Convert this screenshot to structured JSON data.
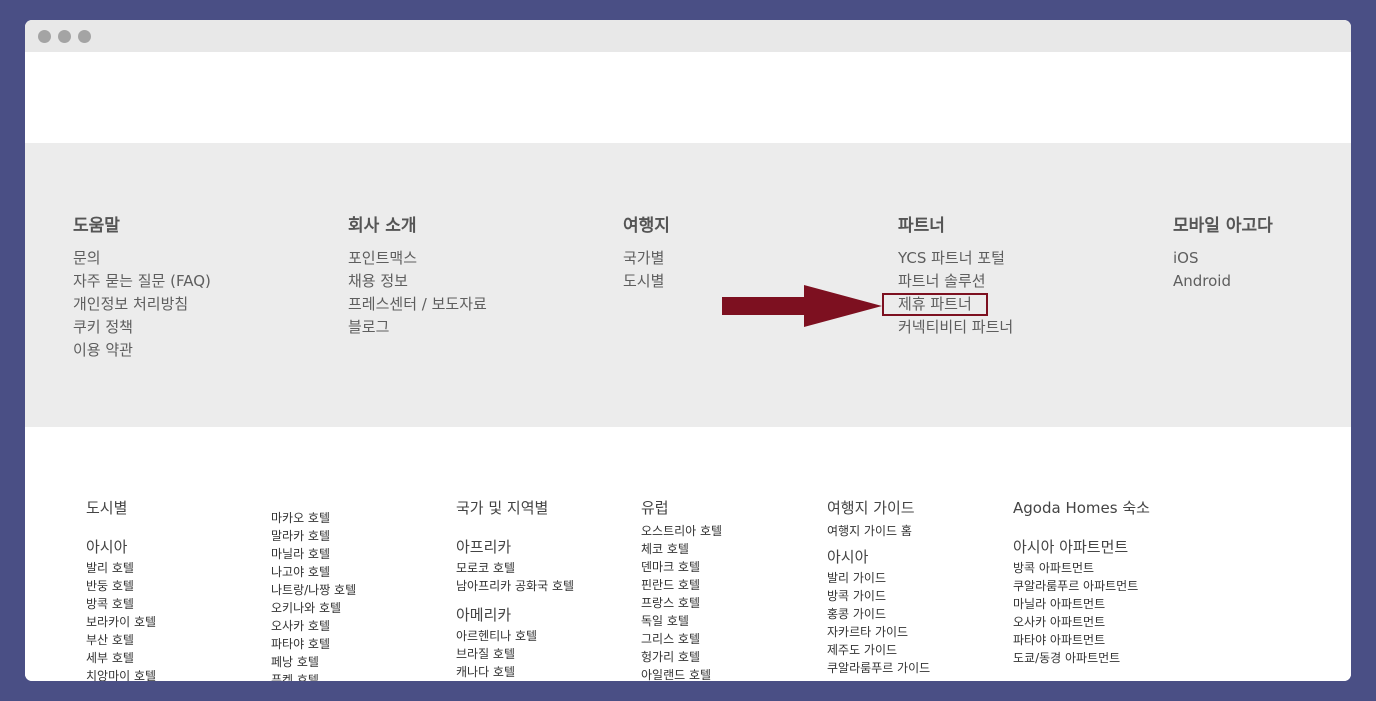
{
  "footer": {
    "columns": [
      {
        "title": "도움말",
        "links": [
          "문의",
          "자주 묻는 질문 (FAQ)",
          "개인정보 처리방침",
          "쿠키 정책",
          "이용 약관"
        ]
      },
      {
        "title": "회사 소개",
        "links": [
          "포인트맥스",
          "채용 정보",
          "프레스센터 / 보도자료",
          "블로그"
        ]
      },
      {
        "title": "여행지",
        "links": [
          "국가별",
          "도시별"
        ]
      },
      {
        "title": "파트너",
        "links": [
          "YCS 파트너 포털",
          "파트너 솔루션",
          "제휴 파트너",
          "커넥티비티 파트너"
        ]
      },
      {
        "title": "모바일 아고다",
        "links": [
          "iOS",
          "Android"
        ]
      }
    ]
  },
  "annotation": {
    "arrow_color": "#7d1020",
    "highlighted_link": "제휴 파트너"
  },
  "directory": {
    "col1": {
      "title": "도시별",
      "region": "아시아",
      "links": [
        "발리 호텔",
        "반둥 호텔",
        "방콕 호텔",
        "보라카이 호텔",
        "부산 호텔",
        "세부 호텔",
        "치앙마이 호텔"
      ]
    },
    "col2": {
      "links": [
        "마카오 호텔",
        "말라카 호텔",
        "마닐라 호텔",
        "나고야 호텔",
        "나트랑/나짱 호텔",
        "오키나와 호텔",
        "오사카 호텔",
        "파타야 호텔",
        "페낭 호텔",
        "푸켓 호텔"
      ]
    },
    "col3": {
      "title": "국가 및 지역별",
      "region1": "아프리카",
      "links1": [
        "모로코 호텔",
        "남아프리카 공화국 호텔"
      ],
      "region2": "아메리카",
      "links2": [
        "아르헨티나 호텔",
        "브라질 호텔",
        "캐나다 호텔"
      ]
    },
    "col4": {
      "title": "유럽",
      "links": [
        "오스트리아 호텔",
        "체코 호텔",
        "덴마크 호텔",
        "핀란드 호텔",
        "프랑스 호텔",
        "독일 호텔",
        "그리스 호텔",
        "헝가리 호텔",
        "아일랜드 호텔"
      ]
    },
    "col5": {
      "title": "여행지 가이드",
      "home_link": "여행지 가이드 홈",
      "region": "아시아",
      "links": [
        "발리 가이드",
        "방콕 가이드",
        "홍콩 가이드",
        "자카르타 가이드",
        "제주도 가이드",
        "쿠알라룸푸르 가이드"
      ]
    },
    "col6": {
      "title": "Agoda Homes 숙소",
      "region": "아시아 아파트먼트",
      "links": [
        "방콕 아파트먼트",
        "쿠알라룸푸르 아파트먼트",
        "마닐라 아파트먼트",
        "오사카 아파트먼트",
        "파타야 아파트먼트",
        "도쿄/동경 아파트먼트"
      ]
    }
  }
}
